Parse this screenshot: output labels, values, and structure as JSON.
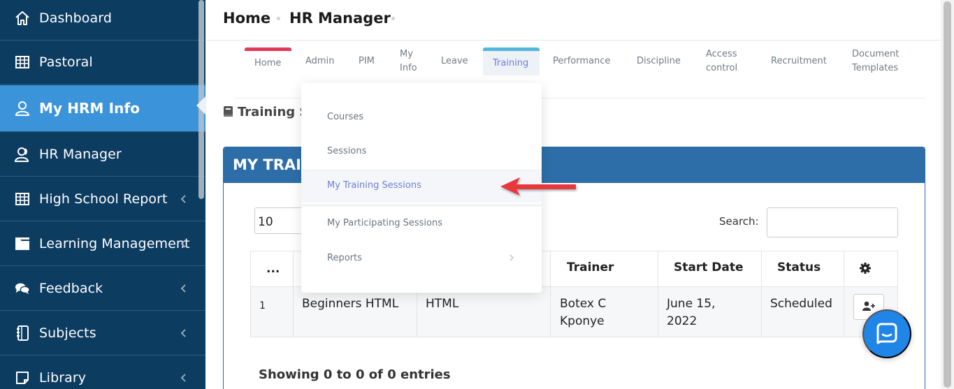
{
  "sidebar": {
    "items": [
      {
        "label": "Dashboard",
        "icon": "home-icon",
        "active": false,
        "has_children": false
      },
      {
        "label": "Pastoral",
        "icon": "table-icon",
        "active": false,
        "has_children": false
      },
      {
        "label": "My HRM Info",
        "icon": "user-icon",
        "active": true,
        "has_children": false
      },
      {
        "label": "HR Manager",
        "icon": "users-icon",
        "active": false,
        "has_children": false
      },
      {
        "label": "High School Report",
        "icon": "table-icon",
        "active": false,
        "has_children": true
      },
      {
        "label": "Learning Management",
        "icon": "folder-icon",
        "active": false,
        "has_children": true
      },
      {
        "label": "Feedback",
        "icon": "comments-icon",
        "active": false,
        "has_children": true
      },
      {
        "label": "Subjects",
        "icon": "notebook-icon",
        "active": false,
        "has_children": true
      },
      {
        "label": "Library",
        "icon": "book-open-icon",
        "active": false,
        "has_children": true
      }
    ]
  },
  "breadcrumb": {
    "home": "Home",
    "current": "HR Manager"
  },
  "tabs": {
    "home": "Home",
    "admin": "Admin",
    "pim": "PIM",
    "my_info_1": "My",
    "my_info_2": "Info",
    "leave": "Leave",
    "training": "Training",
    "performance": "Performance",
    "discipline": "Discipline",
    "access_1": "Access",
    "access_2": "control",
    "recruitment": "Recruitment",
    "doc_1": "Document",
    "doc_2": "Templates"
  },
  "dropdown": {
    "items": [
      "Courses",
      "Sessions",
      "My Training Sessions",
      "My Participating Sessions",
      "Reports"
    ],
    "active_index": 2
  },
  "page": {
    "heading": "Training S",
    "panel_title": "MY TRAI",
    "page_length": "10",
    "search_label": "Search:",
    "info": "Showing 0 to 0 of 0 entries"
  },
  "table": {
    "headers": {
      "num": "...",
      "trainer": "Trainer",
      "start_date": "Start Date",
      "status": "Status"
    },
    "rows": [
      {
        "num": "1",
        "course": "Beginners HTML",
        "session": "HTML",
        "trainer_1": "Botex C",
        "trainer_2": "Kponye",
        "date_1": "June 15,",
        "date_2": "2022",
        "status": "Scheduled"
      }
    ]
  },
  "colors": {
    "sidebar_bg": "#0d3c61",
    "sidebar_active": "#3b93d9",
    "panel_header": "#2d6ea8",
    "tab_home_accent": "#e23a57",
    "tab_training_accent": "#54b6dc",
    "dropdown_active_text": "#6c7fd8",
    "arrow": "#e8383c",
    "chat_button": "#1f85e6"
  }
}
